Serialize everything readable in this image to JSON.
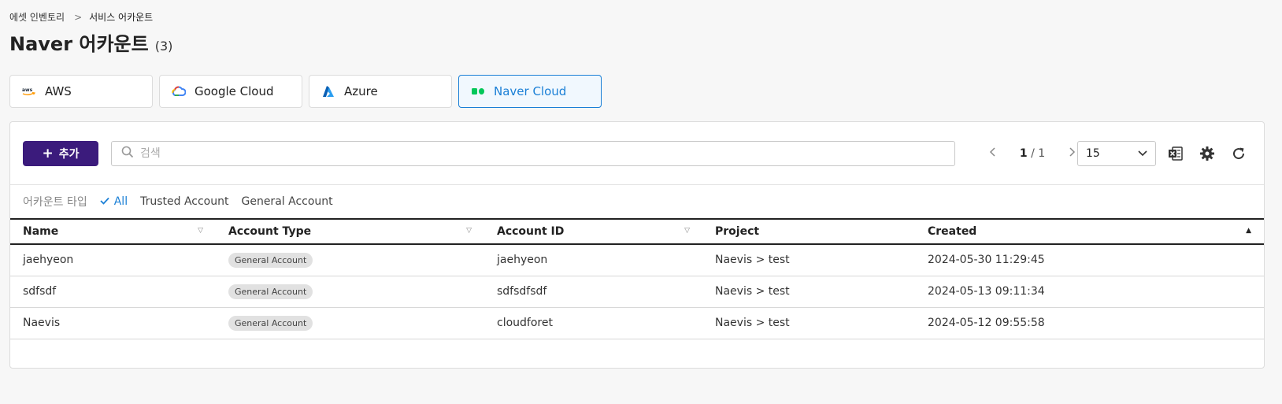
{
  "breadcrumb": {
    "parent": "에셋 인벤토리",
    "separator": ">",
    "current": "서비스 어카운트"
  },
  "page": {
    "title": "Naver 어카운트",
    "count": "(3)"
  },
  "providers": [
    {
      "label": "AWS",
      "icon": "aws-icon"
    },
    {
      "label": "Google Cloud",
      "icon": "google-cloud-icon"
    },
    {
      "label": "Azure",
      "icon": "azure-icon"
    },
    {
      "label": "Naver Cloud",
      "icon": "naver-cloud-icon",
      "selected": true
    }
  ],
  "toolbar": {
    "add_label": "추가",
    "search_placeholder": "검색",
    "page_current": "1",
    "page_total": "/ 1",
    "page_size": "15"
  },
  "filter": {
    "label": "어카운트 타입",
    "options": [
      "All",
      "Trusted Account",
      "General Account"
    ],
    "selected": "All"
  },
  "table": {
    "columns": [
      "Name",
      "Account Type",
      "Account ID",
      "Project",
      "Created"
    ],
    "rows": [
      {
        "name": "jaehyeon",
        "type": "General Account",
        "account_id": "jaehyeon",
        "project": "Naevis > test",
        "created": "2024-05-30 11:29:45"
      },
      {
        "name": "sdfsdf",
        "type": "General Account",
        "account_id": "sdfsdfsdf",
        "project": "Naevis > test",
        "created": "2024-05-13 09:11:34"
      },
      {
        "name": "Naevis",
        "type": "General Account",
        "account_id": "cloudforet",
        "project": "Naevis > test",
        "created": "2024-05-12 09:55:58"
      }
    ]
  },
  "colors": {
    "accent": "#1a7fd6",
    "primary_button": "#3b1b7c",
    "background": "#f7f7f7"
  }
}
